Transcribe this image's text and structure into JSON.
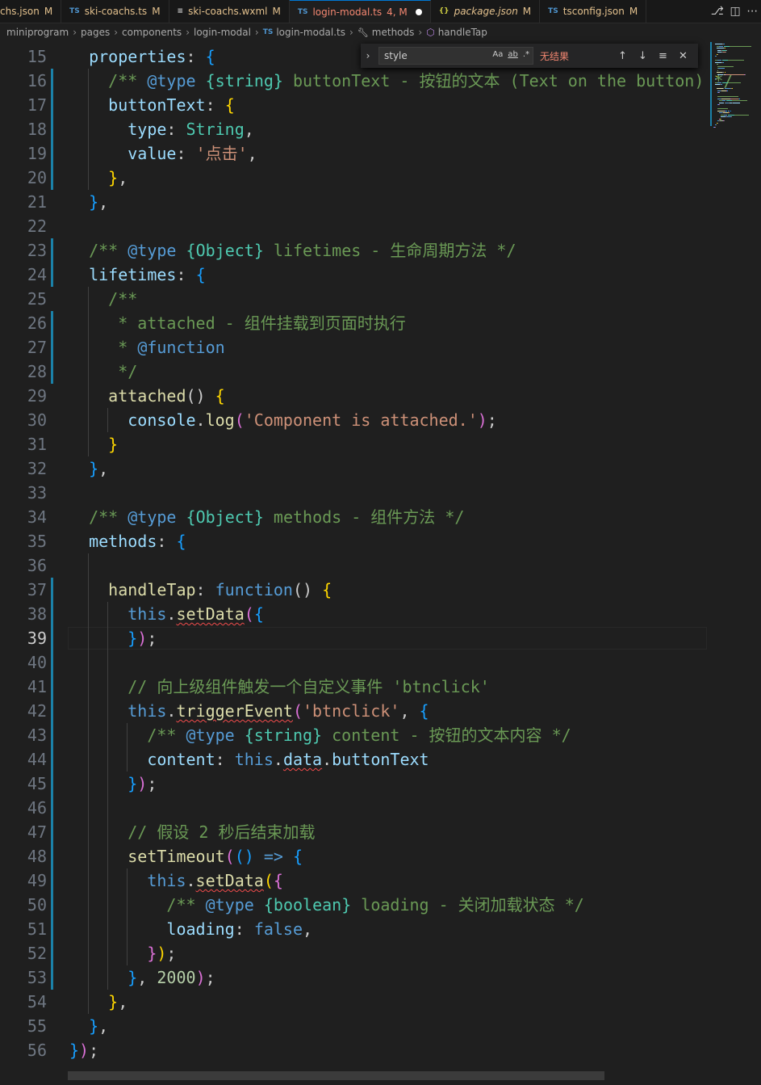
{
  "tabs": [
    {
      "icon": "",
      "name": "chs.json",
      "status": "M",
      "active": false,
      "italic": false
    },
    {
      "icon": "TS",
      "name": "ski-coachs.ts",
      "status": "M",
      "active": false,
      "italic": false
    },
    {
      "icon": "≡",
      "name": "ski-coachs.wxml",
      "status": "M",
      "active": false,
      "italic": false
    },
    {
      "icon": "TS",
      "name": "login-modal.ts",
      "status": "4, M",
      "active": true,
      "italic": false
    },
    {
      "icon": "{}",
      "name": "package.json",
      "status": "M",
      "active": false,
      "italic": true
    },
    {
      "icon": "TS",
      "name": "tsconfig.json",
      "status": "M",
      "active": false,
      "italic": false
    }
  ],
  "tab_actions": [
    "⎇",
    "◫",
    "⋯"
  ],
  "breadcrumb": {
    "items": [
      "miniprogram",
      "pages",
      "components",
      "login-modal",
      "login-modal.ts",
      "methods",
      "handleTap"
    ],
    "ts_icon": "TS"
  },
  "find": {
    "query": "style",
    "match_case": "Aa",
    "whole_word": "ab",
    "regex": ".*",
    "no_results": "无结果",
    "expand": "›",
    "prev": "↑",
    "next": "↓",
    "selection": "≡",
    "close": "✕"
  },
  "editor": {
    "current_line": 39,
    "lines": [
      {
        "n": 15,
        "t": [
          [
            "  ",
            "txt"
          ],
          [
            "properties",
            "prop"
          ],
          [
            ": ",
            "txt"
          ],
          [
            "{",
            "br3"
          ]
        ]
      },
      {
        "n": 16,
        "t": [
          [
            "    ",
            "txt"
          ],
          [
            "/** ",
            "cmt"
          ],
          [
            "@type",
            "kw"
          ],
          [
            " ",
            "cmt"
          ],
          [
            "{string}",
            "type"
          ],
          [
            " buttonText - 按钮的文本 (Text on the button) */",
            "cmt"
          ]
        ]
      },
      {
        "n": 17,
        "t": [
          [
            "    ",
            "txt"
          ],
          [
            "buttonText",
            "prop"
          ],
          [
            ": ",
            "txt"
          ],
          [
            "{",
            "br1"
          ]
        ]
      },
      {
        "n": 18,
        "t": [
          [
            "      ",
            "txt"
          ],
          [
            "type",
            "prop"
          ],
          [
            ": ",
            "txt"
          ],
          [
            "String",
            "type"
          ],
          [
            ",",
            "txt"
          ]
        ]
      },
      {
        "n": 19,
        "t": [
          [
            "      ",
            "txt"
          ],
          [
            "value",
            "prop"
          ],
          [
            ": ",
            "txt"
          ],
          [
            "'点击'",
            "str"
          ],
          [
            ",",
            "txt"
          ]
        ]
      },
      {
        "n": 20,
        "t": [
          [
            "    ",
            "txt"
          ],
          [
            "}",
            "br1"
          ],
          [
            ",",
            "txt"
          ]
        ]
      },
      {
        "n": 21,
        "t": [
          [
            "  ",
            "txt"
          ],
          [
            "}",
            "br3"
          ],
          [
            ",",
            "txt"
          ]
        ]
      },
      {
        "n": 22,
        "t": []
      },
      {
        "n": 23,
        "t": [
          [
            "  ",
            "txt"
          ],
          [
            "/** ",
            "cmt"
          ],
          [
            "@type",
            "kw"
          ],
          [
            " ",
            "cmt"
          ],
          [
            "{Object}",
            "type"
          ],
          [
            " lifetimes - 生命周期方法 */",
            "cmt"
          ]
        ]
      },
      {
        "n": 24,
        "t": [
          [
            "  ",
            "txt"
          ],
          [
            "lifetimes",
            "prop"
          ],
          [
            ": ",
            "txt"
          ],
          [
            "{",
            "br3"
          ]
        ]
      },
      {
        "n": 25,
        "t": [
          [
            "    ",
            "txt"
          ],
          [
            "/**",
            "cmt"
          ]
        ]
      },
      {
        "n": 26,
        "t": [
          [
            "     ",
            "txt"
          ],
          [
            "* attached - 组件挂载到页面时执行",
            "cmt"
          ]
        ]
      },
      {
        "n": 27,
        "t": [
          [
            "     ",
            "txt"
          ],
          [
            "* ",
            "cmt"
          ],
          [
            "@function",
            "kw"
          ]
        ]
      },
      {
        "n": 28,
        "t": [
          [
            "     ",
            "txt"
          ],
          [
            "*/",
            "cmt"
          ]
        ]
      },
      {
        "n": 29,
        "t": [
          [
            "    ",
            "txt"
          ],
          [
            "attached",
            "fn"
          ],
          [
            "() ",
            "txt"
          ],
          [
            "{",
            "br1"
          ]
        ]
      },
      {
        "n": 30,
        "t": [
          [
            "      ",
            "txt"
          ],
          [
            "console",
            "prop"
          ],
          [
            ".",
            "txt"
          ],
          [
            "log",
            "fn"
          ],
          [
            "(",
            "br2"
          ],
          [
            "'Component is attached.'",
            "str"
          ],
          [
            ")",
            "br2"
          ],
          [
            ";",
            "txt"
          ]
        ]
      },
      {
        "n": 31,
        "t": [
          [
            "    ",
            "txt"
          ],
          [
            "}",
            "br1"
          ]
        ]
      },
      {
        "n": 32,
        "t": [
          [
            "  ",
            "txt"
          ],
          [
            "}",
            "br3"
          ],
          [
            ",",
            "txt"
          ]
        ]
      },
      {
        "n": 33,
        "t": []
      },
      {
        "n": 34,
        "t": [
          [
            "  ",
            "txt"
          ],
          [
            "/** ",
            "cmt"
          ],
          [
            "@type",
            "kw"
          ],
          [
            " ",
            "cmt"
          ],
          [
            "{Object}",
            "type"
          ],
          [
            " methods - 组件方法 */",
            "cmt"
          ]
        ]
      },
      {
        "n": 35,
        "t": [
          [
            "  ",
            "txt"
          ],
          [
            "methods",
            "prop"
          ],
          [
            ": ",
            "txt"
          ],
          [
            "{",
            "br3"
          ]
        ]
      },
      {
        "n": 36,
        "t": []
      },
      {
        "n": 37,
        "t": [
          [
            "    ",
            "txt"
          ],
          [
            "handleTap",
            "fn"
          ],
          [
            ": ",
            "txt"
          ],
          [
            "function",
            "kw"
          ],
          [
            "() ",
            "txt"
          ],
          [
            "{",
            "br1"
          ]
        ]
      },
      {
        "n": 38,
        "t": [
          [
            "      ",
            "txt"
          ],
          [
            "this",
            "kw"
          ],
          [
            ".",
            "txt"
          ],
          [
            "setData",
            "fn",
            "squig"
          ],
          [
            "(",
            "br2"
          ],
          [
            "{",
            "br3"
          ]
        ]
      },
      {
        "n": 39,
        "t": [
          [
            "      ",
            "txt"
          ],
          [
            "}",
            "br3"
          ],
          [
            ")",
            "br2"
          ],
          [
            ";",
            "txt"
          ]
        ]
      },
      {
        "n": 40,
        "t": []
      },
      {
        "n": 41,
        "t": [
          [
            "      ",
            "txt"
          ],
          [
            "// 向上级组件触发一个自定义事件 'btnclick'",
            "cmt"
          ]
        ]
      },
      {
        "n": 42,
        "t": [
          [
            "      ",
            "txt"
          ],
          [
            "this",
            "kw"
          ],
          [
            ".",
            "txt"
          ],
          [
            "triggerEvent",
            "fn",
            "squig"
          ],
          [
            "(",
            "br2"
          ],
          [
            "'btnclick'",
            "str"
          ],
          [
            ", ",
            "txt"
          ],
          [
            "{",
            "br3"
          ]
        ]
      },
      {
        "n": 43,
        "t": [
          [
            "        ",
            "txt"
          ],
          [
            "/** ",
            "cmt"
          ],
          [
            "@type",
            "kw"
          ],
          [
            " ",
            "cmt"
          ],
          [
            "{string}",
            "type"
          ],
          [
            " content - 按钮的文本内容 */",
            "cmt"
          ]
        ]
      },
      {
        "n": 44,
        "t": [
          [
            "        ",
            "txt"
          ],
          [
            "content",
            "prop"
          ],
          [
            ": ",
            "txt"
          ],
          [
            "this",
            "kw"
          ],
          [
            ".",
            "txt"
          ],
          [
            "data",
            "prop",
            "squig"
          ],
          [
            ".",
            "txt"
          ],
          [
            "buttonText",
            "prop"
          ]
        ]
      },
      {
        "n": 45,
        "t": [
          [
            "      ",
            "txt"
          ],
          [
            "}",
            "br3"
          ],
          [
            ")",
            "br2"
          ],
          [
            ";",
            "txt"
          ]
        ]
      },
      {
        "n": 46,
        "t": []
      },
      {
        "n": 47,
        "t": [
          [
            "      ",
            "txt"
          ],
          [
            "// 假设 2 秒后结束加载",
            "cmt"
          ]
        ]
      },
      {
        "n": 48,
        "t": [
          [
            "      ",
            "txt"
          ],
          [
            "setTimeout",
            "fn"
          ],
          [
            "(",
            "br2"
          ],
          [
            "()",
            "br3"
          ],
          [
            " ",
            "txt"
          ],
          [
            "=>",
            "kw"
          ],
          [
            " ",
            "txt"
          ],
          [
            "{",
            "br3"
          ]
        ]
      },
      {
        "n": 49,
        "t": [
          [
            "        ",
            "txt"
          ],
          [
            "this",
            "kw"
          ],
          [
            ".",
            "txt"
          ],
          [
            "setData",
            "fn",
            "squig"
          ],
          [
            "(",
            "br1"
          ],
          [
            "{",
            "br2"
          ]
        ]
      },
      {
        "n": 50,
        "t": [
          [
            "          ",
            "txt"
          ],
          [
            "/** ",
            "cmt"
          ],
          [
            "@type",
            "kw"
          ],
          [
            " ",
            "cmt"
          ],
          [
            "{boolean}",
            "type"
          ],
          [
            " loading - 关闭加载状态 */",
            "cmt"
          ]
        ]
      },
      {
        "n": 51,
        "t": [
          [
            "          ",
            "txt"
          ],
          [
            "loading",
            "prop"
          ],
          [
            ": ",
            "txt"
          ],
          [
            "false",
            "kw"
          ],
          [
            ",",
            "txt"
          ]
        ]
      },
      {
        "n": 52,
        "t": [
          [
            "        ",
            "txt"
          ],
          [
            "}",
            "br2"
          ],
          [
            ")",
            "br1"
          ],
          [
            ";",
            "txt"
          ]
        ]
      },
      {
        "n": 53,
        "t": [
          [
            "      ",
            "txt"
          ],
          [
            "}",
            "br3"
          ],
          [
            ", ",
            "txt"
          ],
          [
            "2000",
            "num"
          ],
          [
            ")",
            "br2"
          ],
          [
            ";",
            "txt"
          ]
        ]
      },
      {
        "n": 54,
        "t": [
          [
            "    ",
            "txt"
          ],
          [
            "}",
            "br1"
          ],
          [
            ",",
            "txt"
          ]
        ]
      },
      {
        "n": 55,
        "t": [
          [
            "  ",
            "txt"
          ],
          [
            "}",
            "br3"
          ],
          [
            ",",
            "txt"
          ]
        ]
      },
      {
        "n": 56,
        "t": [
          [
            "}",
            "br3"
          ],
          [
            ")",
            "br2"
          ],
          [
            ";",
            "txt"
          ]
        ]
      }
    ]
  }
}
